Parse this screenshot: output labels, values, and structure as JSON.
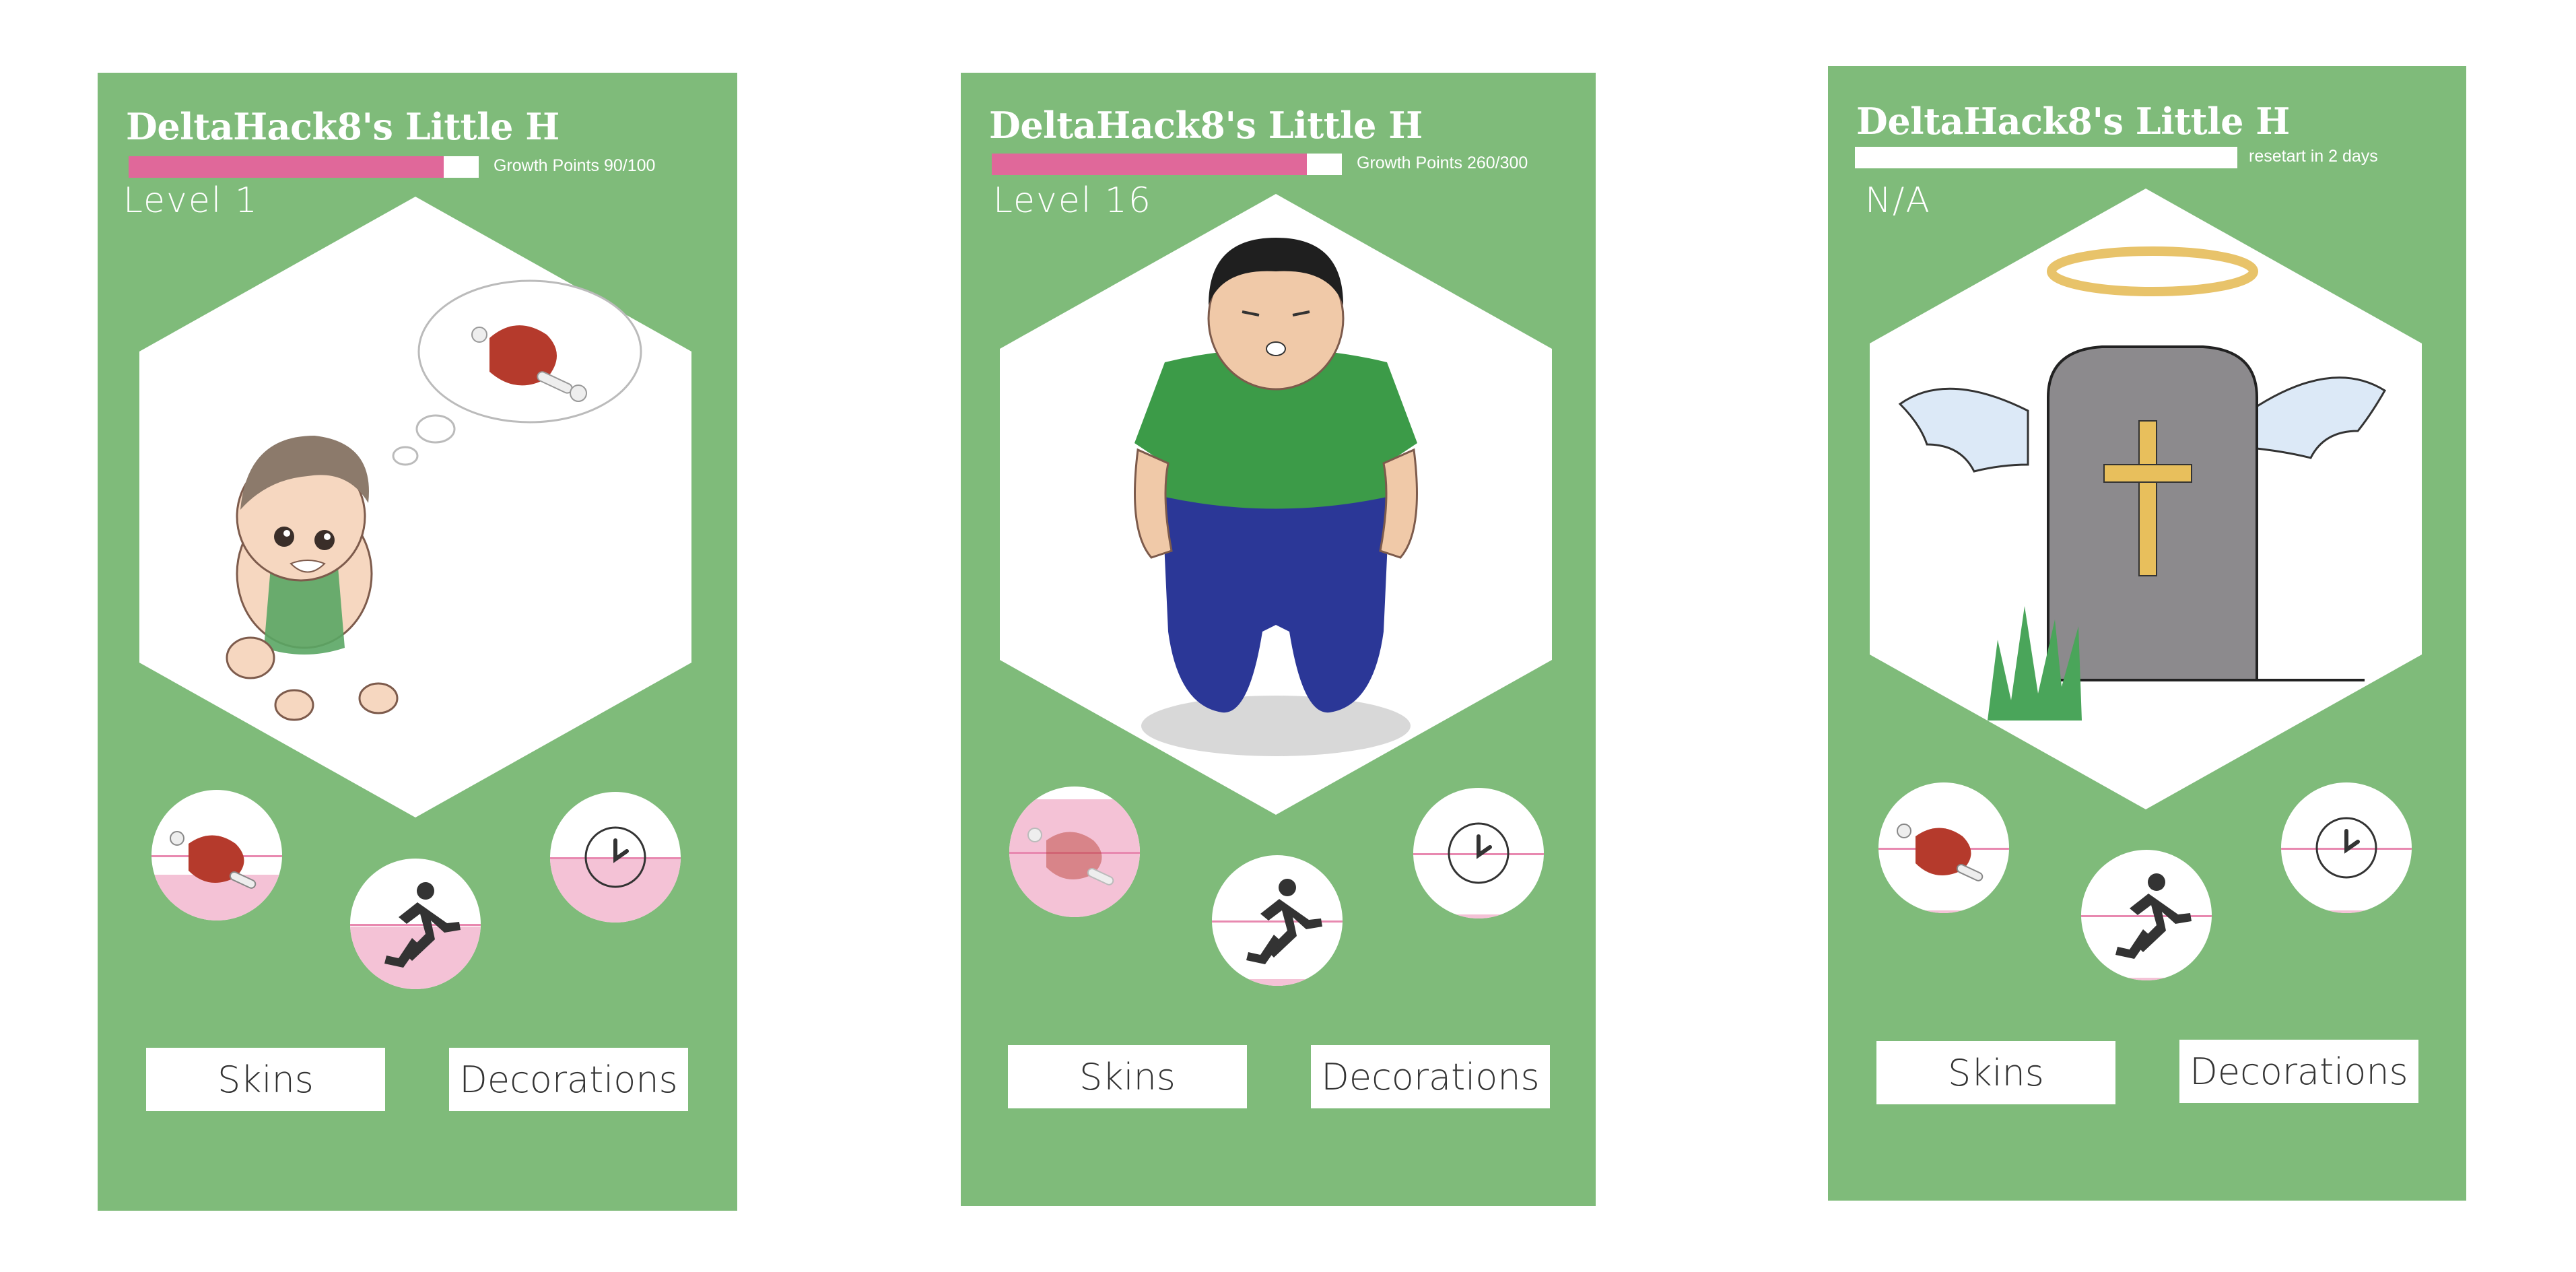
{
  "screens": [
    {
      "title": "DeltaHack8's Little H",
      "progress_label": "Growth Points 90/100",
      "progress_fraction": 0.9,
      "level": "Level 1",
      "character": "crawling-baby-dreaming-of-meat",
      "meter_levels": {
        "food": 0.35,
        "exercise": 0.48,
        "time": 0.5
      },
      "skins_label": "Skins",
      "decorations_label": "Decorations"
    },
    {
      "title": "DeltaHack8's Little H",
      "progress_label": "Growth Points 260/300",
      "progress_fraction": 0.87,
      "level": "Level 16",
      "character": "overweight-man-green-shirt",
      "meter_levels": {
        "food": 0.9,
        "exercise": 0.05,
        "time": 0.03
      },
      "skins_label": "Skins",
      "decorations_label": "Decorations"
    },
    {
      "title": "DeltaHack8's Little H",
      "progress_label": "resetart in 2 days",
      "progress_fraction": 0,
      "level": "N/A",
      "character": "tombstone-with-halo-and-wings",
      "meter_levels": {
        "food": 0.02,
        "exercise": 0.02,
        "time": 0.02
      },
      "skins_label": "Skins",
      "decorations_label": "Decorations"
    }
  ],
  "icons": {
    "food": "meat-icon",
    "exercise": "running-person-icon",
    "time": "clock-icon"
  },
  "colors": {
    "card_green": "#7fbb7a",
    "progress_pink": "#e0689a",
    "meter_pink": "#f4c2d6",
    "meter_line": "#e889b0"
  }
}
